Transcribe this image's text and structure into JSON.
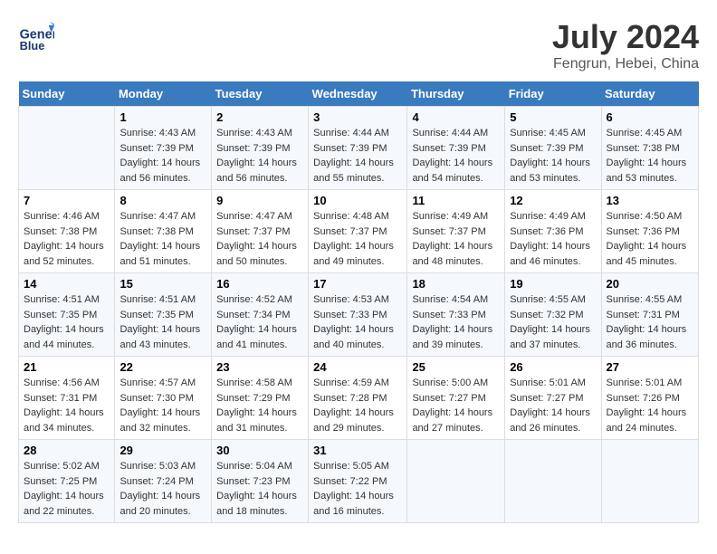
{
  "header": {
    "logo_line1": "General",
    "logo_line2": "Blue",
    "main_title": "July 2024",
    "subtitle": "Fengrun, Hebei, China"
  },
  "days_of_week": [
    "Sunday",
    "Monday",
    "Tuesday",
    "Wednesday",
    "Thursday",
    "Friday",
    "Saturday"
  ],
  "weeks": [
    [
      {
        "day": "",
        "info": ""
      },
      {
        "day": "1",
        "info": "Sunrise: 4:43 AM\nSunset: 7:39 PM\nDaylight: 14 hours\nand 56 minutes."
      },
      {
        "day": "2",
        "info": "Sunrise: 4:43 AM\nSunset: 7:39 PM\nDaylight: 14 hours\nand 56 minutes."
      },
      {
        "day": "3",
        "info": "Sunrise: 4:44 AM\nSunset: 7:39 PM\nDaylight: 14 hours\nand 55 minutes."
      },
      {
        "day": "4",
        "info": "Sunrise: 4:44 AM\nSunset: 7:39 PM\nDaylight: 14 hours\nand 54 minutes."
      },
      {
        "day": "5",
        "info": "Sunrise: 4:45 AM\nSunset: 7:39 PM\nDaylight: 14 hours\nand 53 minutes."
      },
      {
        "day": "6",
        "info": "Sunrise: 4:45 AM\nSunset: 7:38 PM\nDaylight: 14 hours\nand 53 minutes."
      }
    ],
    [
      {
        "day": "7",
        "info": "Sunrise: 4:46 AM\nSunset: 7:38 PM\nDaylight: 14 hours\nand 52 minutes."
      },
      {
        "day": "8",
        "info": "Sunrise: 4:47 AM\nSunset: 7:38 PM\nDaylight: 14 hours\nand 51 minutes."
      },
      {
        "day": "9",
        "info": "Sunrise: 4:47 AM\nSunset: 7:37 PM\nDaylight: 14 hours\nand 50 minutes."
      },
      {
        "day": "10",
        "info": "Sunrise: 4:48 AM\nSunset: 7:37 PM\nDaylight: 14 hours\nand 49 minutes."
      },
      {
        "day": "11",
        "info": "Sunrise: 4:49 AM\nSunset: 7:37 PM\nDaylight: 14 hours\nand 48 minutes."
      },
      {
        "day": "12",
        "info": "Sunrise: 4:49 AM\nSunset: 7:36 PM\nDaylight: 14 hours\nand 46 minutes."
      },
      {
        "day": "13",
        "info": "Sunrise: 4:50 AM\nSunset: 7:36 PM\nDaylight: 14 hours\nand 45 minutes."
      }
    ],
    [
      {
        "day": "14",
        "info": "Sunrise: 4:51 AM\nSunset: 7:35 PM\nDaylight: 14 hours\nand 44 minutes."
      },
      {
        "day": "15",
        "info": "Sunrise: 4:51 AM\nSunset: 7:35 PM\nDaylight: 14 hours\nand 43 minutes."
      },
      {
        "day": "16",
        "info": "Sunrise: 4:52 AM\nSunset: 7:34 PM\nDaylight: 14 hours\nand 41 minutes."
      },
      {
        "day": "17",
        "info": "Sunrise: 4:53 AM\nSunset: 7:33 PM\nDaylight: 14 hours\nand 40 minutes."
      },
      {
        "day": "18",
        "info": "Sunrise: 4:54 AM\nSunset: 7:33 PM\nDaylight: 14 hours\nand 39 minutes."
      },
      {
        "day": "19",
        "info": "Sunrise: 4:55 AM\nSunset: 7:32 PM\nDaylight: 14 hours\nand 37 minutes."
      },
      {
        "day": "20",
        "info": "Sunrise: 4:55 AM\nSunset: 7:31 PM\nDaylight: 14 hours\nand 36 minutes."
      }
    ],
    [
      {
        "day": "21",
        "info": "Sunrise: 4:56 AM\nSunset: 7:31 PM\nDaylight: 14 hours\nand 34 minutes."
      },
      {
        "day": "22",
        "info": "Sunrise: 4:57 AM\nSunset: 7:30 PM\nDaylight: 14 hours\nand 32 minutes."
      },
      {
        "day": "23",
        "info": "Sunrise: 4:58 AM\nSunset: 7:29 PM\nDaylight: 14 hours\nand 31 minutes."
      },
      {
        "day": "24",
        "info": "Sunrise: 4:59 AM\nSunset: 7:28 PM\nDaylight: 14 hours\nand 29 minutes."
      },
      {
        "day": "25",
        "info": "Sunrise: 5:00 AM\nSunset: 7:27 PM\nDaylight: 14 hours\nand 27 minutes."
      },
      {
        "day": "26",
        "info": "Sunrise: 5:01 AM\nSunset: 7:27 PM\nDaylight: 14 hours\nand 26 minutes."
      },
      {
        "day": "27",
        "info": "Sunrise: 5:01 AM\nSunset: 7:26 PM\nDaylight: 14 hours\nand 24 minutes."
      }
    ],
    [
      {
        "day": "28",
        "info": "Sunrise: 5:02 AM\nSunset: 7:25 PM\nDaylight: 14 hours\nand 22 minutes."
      },
      {
        "day": "29",
        "info": "Sunrise: 5:03 AM\nSunset: 7:24 PM\nDaylight: 14 hours\nand 20 minutes."
      },
      {
        "day": "30",
        "info": "Sunrise: 5:04 AM\nSunset: 7:23 PM\nDaylight: 14 hours\nand 18 minutes."
      },
      {
        "day": "31",
        "info": "Sunrise: 5:05 AM\nSunset: 7:22 PM\nDaylight: 14 hours\nand 16 minutes."
      },
      {
        "day": "",
        "info": ""
      },
      {
        "day": "",
        "info": ""
      },
      {
        "day": "",
        "info": ""
      }
    ]
  ]
}
